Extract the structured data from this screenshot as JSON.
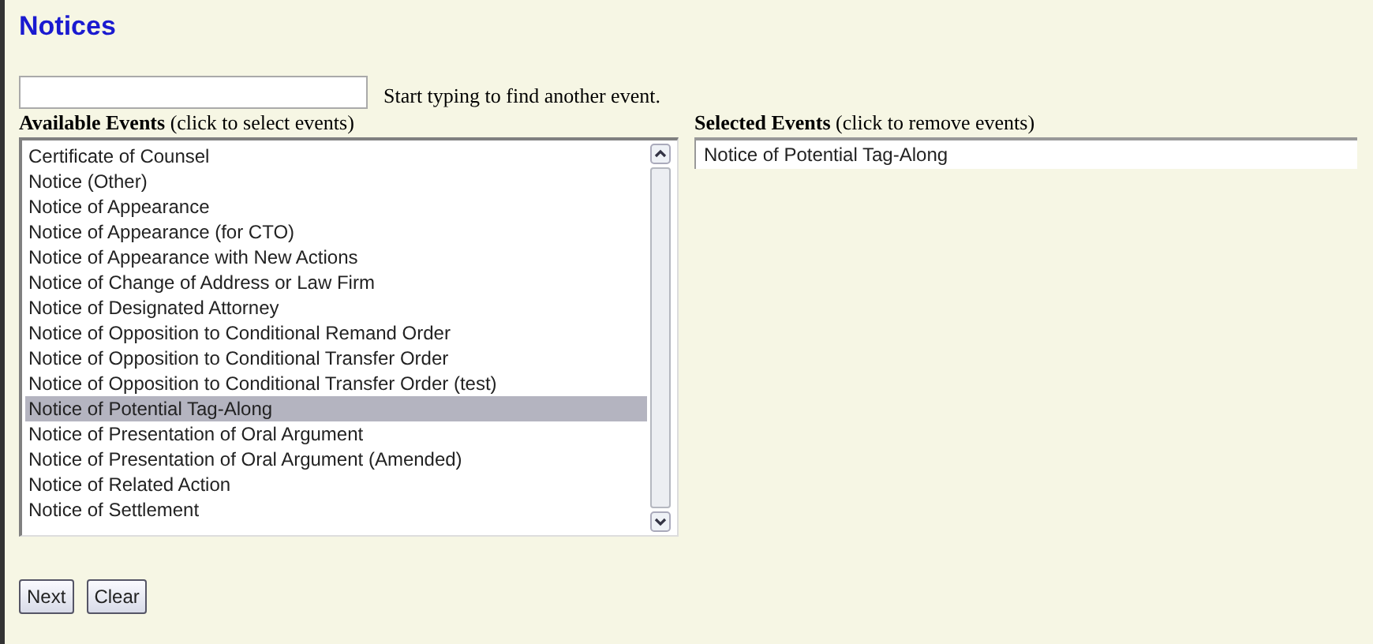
{
  "title": "Notices",
  "search": {
    "hint": "Start typing to find another event."
  },
  "available": {
    "heading": "**Available Events** (click to select events)",
    "items": [
      {
        "label": "Certificate of Counsel",
        "selected": false
      },
      {
        "label": "Notice (Other)",
        "selected": false
      },
      {
        "label": "Notice of Appearance",
        "selected": false
      },
      {
        "label": "Notice of Appearance (for CTO)",
        "selected": false
      },
      {
        "label": "Notice of Appearance with New Actions",
        "selected": false
      },
      {
        "label": "Notice of Change of Address or Law Firm",
        "selected": false
      },
      {
        "label": "Notice of Designated Attorney",
        "selected": false
      },
      {
        "label": "Notice of Opposition to Conditional Remand Order",
        "selected": false
      },
      {
        "label": "Notice of Opposition to Conditional Transfer Order",
        "selected": false
      },
      {
        "label": "Notice of Opposition to Conditional Transfer Order (test)",
        "selected": false
      },
      {
        "label": "Notice of Potential Tag-Along",
        "selected": true
      },
      {
        "label": "Notice of Presentation of Oral Argument",
        "selected": false
      },
      {
        "label": "Notice of Presentation of Oral Argument (Amended)",
        "selected": false
      },
      {
        "label": "Notice of Related Action",
        "selected": false
      },
      {
        "label": "Notice of Settlement",
        "selected": false
      }
    ]
  },
  "selected_events": {
    "heading": "**Selected Events** (click to remove events)",
    "items": [
      "Notice of Potential Tag-Along"
    ]
  },
  "buttons": [
    "Next",
    "Clear"
  ]
}
